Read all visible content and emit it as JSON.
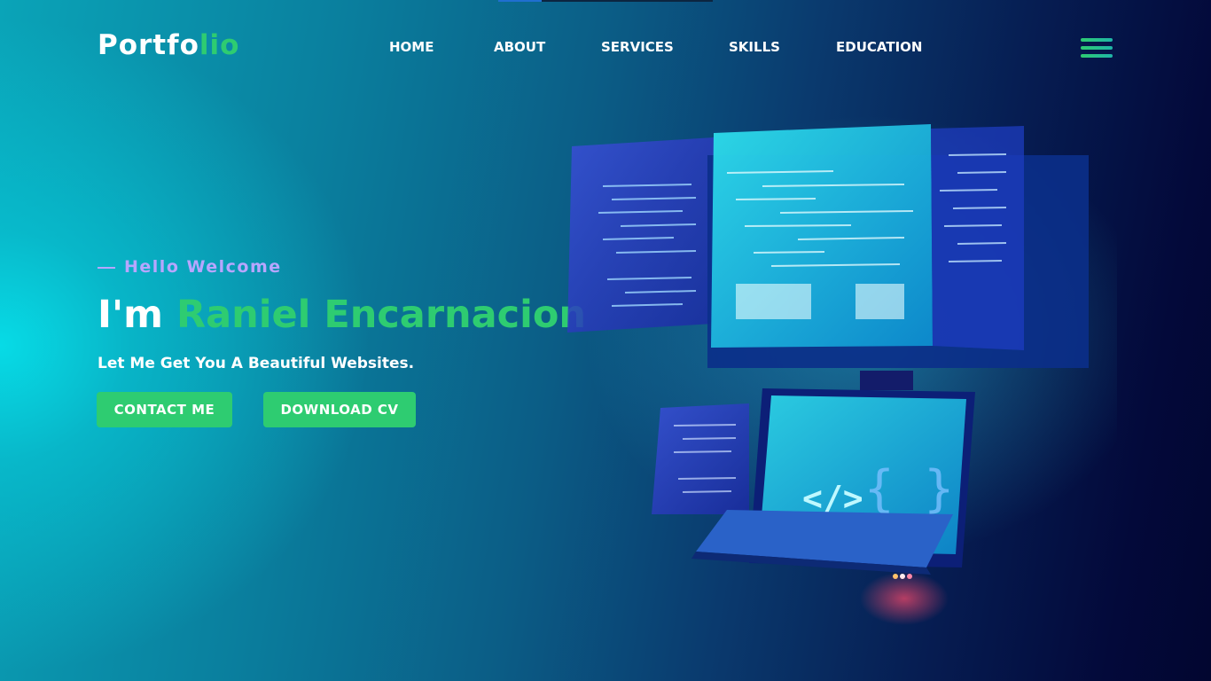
{
  "header": {
    "logo_main": "Portfo",
    "logo_accent": "lio",
    "nav": [
      {
        "label": "HOME"
      },
      {
        "label": "ABOUT"
      },
      {
        "label": "SERVICES"
      },
      {
        "label": "SKILLS"
      },
      {
        "label": "EDUCATION"
      }
    ],
    "menu_icon": "hamburger-menu-icon"
  },
  "hero": {
    "greeting": "Hello Welcome",
    "headline_prefix": "I'm",
    "headline_name": "Raniel Encarnacion",
    "tagline": "Let Me Get You A Beautiful Websites.",
    "buttons": {
      "contact": "CONTACT ME",
      "download": "DOWNLOAD CV"
    },
    "illustration_code_symbols": [
      "</>",
      "{ }"
    ]
  },
  "colors": {
    "accent": "#2ecc71",
    "greeting": "#b7a6ff",
    "text": "#ffffff",
    "background_light": "#07dbe6",
    "background_dark": "#020630"
  }
}
